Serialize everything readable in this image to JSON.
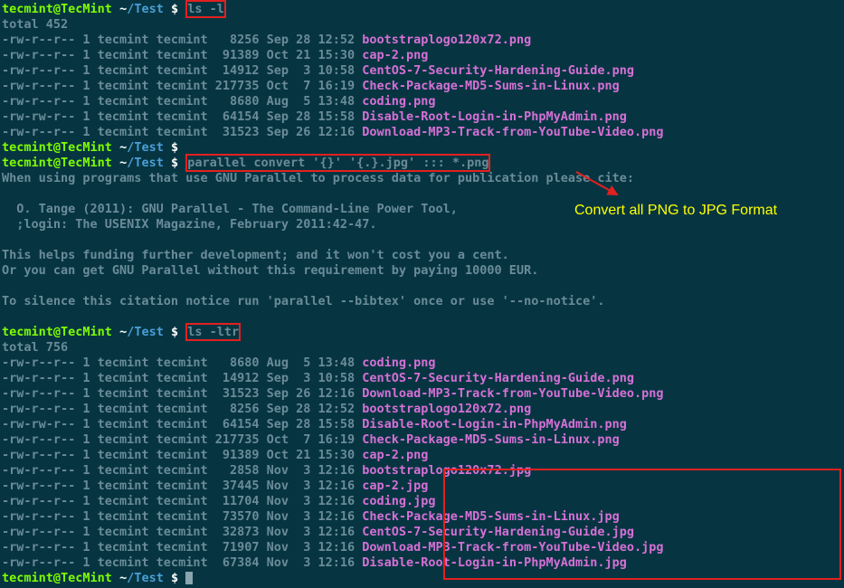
{
  "prompt": {
    "user_host": "tecmint@TecMint",
    "path_tilde": "~",
    "path_dir": "/Test",
    "dollar": " $ "
  },
  "cmd1": "ls -l",
  "total1": "total 452",
  "listing1": [
    {
      "perm": "-rw-r--r-- 1 tecmint tecmint   8256 Sep 28 12:52 ",
      "name": "bootstraplogo120x72.png"
    },
    {
      "perm": "-rw-r--r-- 1 tecmint tecmint  91389 Oct 21 15:30 ",
      "name": "cap-2.png"
    },
    {
      "perm": "-rw-r--r-- 1 tecmint tecmint  14912 Sep  3 10:58 ",
      "name": "CentOS-7-Security-Hardening-Guide.png"
    },
    {
      "perm": "-rw-r--r-- 1 tecmint tecmint 217735 Oct  7 16:19 ",
      "name": "Check-Package-MD5-Sums-in-Linux.png"
    },
    {
      "perm": "-rw-r--r-- 1 tecmint tecmint   8680 Aug  5 13:48 ",
      "name": "coding.png"
    },
    {
      "perm": "-rw-rw-r-- 1 tecmint tecmint  64154 Sep 28 15:58 ",
      "name": "Disable-Root-Login-in-PhpMyAdmin.png"
    },
    {
      "perm": "-rw-r--r-- 1 tecmint tecmint  31523 Sep 26 12:16 ",
      "name": "Download-MP3-Track-from-YouTube-Video.png"
    }
  ],
  "cmd2": "parallel convert '{}' '{.}.jpg' ::: *.png",
  "output2": [
    "When using programs that use GNU Parallel to process data for publication please cite:",
    "",
    "  O. Tange (2011): GNU Parallel - The Command-Line Power Tool,",
    "  ;login: The USENIX Magazine, February 2011:42-47.",
    "",
    "This helps funding further development; and it won't cost you a cent.",
    "Or you can get GNU Parallel without this requirement by paying 10000 EUR.",
    "",
    "To silence this citation notice run 'parallel --bibtex' once or use '--no-notice'."
  ],
  "cmd3": "ls -ltr",
  "total3": "total 756",
  "listing3a": [
    {
      "perm": "-rw-r--r-- 1 tecmint tecmint   8680 Aug  5 13:48 ",
      "name": "coding.png"
    },
    {
      "perm": "-rw-r--r-- 1 tecmint tecmint  14912 Sep  3 10:58 ",
      "name": "CentOS-7-Security-Hardening-Guide.png"
    },
    {
      "perm": "-rw-r--r-- 1 tecmint tecmint  31523 Sep 26 12:16 ",
      "name": "Download-MP3-Track-from-YouTube-Video.png"
    },
    {
      "perm": "-rw-r--r-- 1 tecmint tecmint   8256 Sep 28 12:52 ",
      "name": "bootstraplogo120x72.png"
    },
    {
      "perm": "-rw-rw-r-- 1 tecmint tecmint  64154 Sep 28 15:58 ",
      "name": "Disable-Root-Login-in-PhpMyAdmin.png"
    },
    {
      "perm": "-rw-r--r-- 1 tecmint tecmint 217735 Oct  7 16:19 ",
      "name": "Check-Package-MD5-Sums-in-Linux.png"
    },
    {
      "perm": "-rw-r--r-- 1 tecmint tecmint  91389 Oct 21 15:30 ",
      "name": "cap-2.png"
    }
  ],
  "listing3b": [
    {
      "perm": "-rw-r--r-- 1 tecmint tecmint   2858 Nov  3 12:16 ",
      "name": "bootstraplogo120x72.jpg"
    },
    {
      "perm": "-rw-r--r-- 1 tecmint tecmint  37445 Nov  3 12:16 ",
      "name": "cap-2.jpg"
    },
    {
      "perm": "-rw-r--r-- 1 tecmint tecmint  11704 Nov  3 12:16 ",
      "name": "coding.jpg"
    },
    {
      "perm": "-rw-r--r-- 1 tecmint tecmint  73570 Nov  3 12:16 ",
      "name": "Check-Package-MD5-Sums-in-Linux.jpg"
    },
    {
      "perm": "-rw-r--r-- 1 tecmint tecmint  32873 Nov  3 12:16 ",
      "name": "CentOS-7-Security-Hardening-Guide.jpg"
    },
    {
      "perm": "-rw-r--r-- 1 tecmint tecmint  71907 Nov  3 12:16 ",
      "name": "Download-MP3-Track-from-YouTube-Video.jpg"
    },
    {
      "perm": "-rw-r--r-- 1 tecmint tecmint  67384 Nov  3 12:16 ",
      "name": "Disable-Root-Login-in-PhpMyAdmin.jpg"
    }
  ],
  "annotation": "Convert all PNG to JPG Format"
}
